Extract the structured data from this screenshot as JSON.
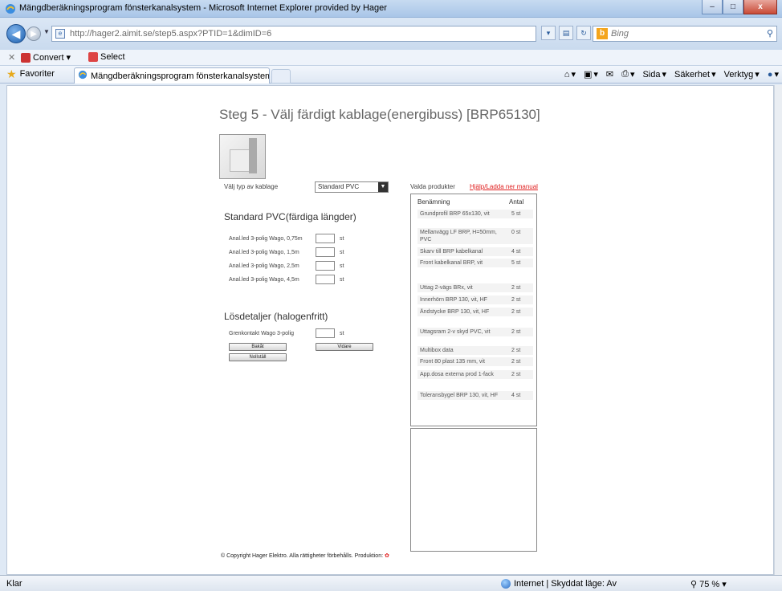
{
  "window": {
    "title": "Mängdberäkningsprogram fönsterkanalsystem - Microsoft Internet Explorer provided by Hager",
    "min_label": "–",
    "max_label": "□",
    "close_label": "x"
  },
  "address": {
    "url": "http://hager2.aimit.se/step5.aspx?PTID=1&dimID=6",
    "search_placeholder": "Bing"
  },
  "command_bar": {
    "convert_label": "Convert",
    "select_label": "Select"
  },
  "favorites": {
    "favorites_label": "Favoriter",
    "tab_title": "Mängdberäkningsprogram fönsterkanalsystem",
    "sida_label": "Sida",
    "sakerhet_label": "Säkerhet",
    "verktyg_label": "Verktyg"
  },
  "page": {
    "heading": "Steg 5 - Välj färdigt kablage(energibuss) [BRP65130]",
    "type_label": "Välj typ av kablage",
    "type_selected": "Standard PVC",
    "selected_products_label": "Valda produkter",
    "help_link": "Hjälp/Ladda ner manual",
    "section1_title": "Standard PVC(färdiga längder)",
    "section1_rows": [
      {
        "label": "Anal.led 3-polig Wago, 0,75m",
        "unit": "st"
      },
      {
        "label": "Anal.led 3-polig Wago, 1,5m",
        "unit": "st"
      },
      {
        "label": "Anal.led 3-polig Wago, 2,5m",
        "unit": "st"
      },
      {
        "label": "Anal.led 3-polig Wago, 4,5m",
        "unit": "st"
      }
    ],
    "section2_title": "Lösdetaljer (halogenfritt)",
    "section2_rows": [
      {
        "label": "Grenkontakt Wago 3-polig",
        "unit": "st"
      }
    ],
    "back_button": "Bakåt",
    "next_button": "Vidare",
    "reset_button": "Nollställ",
    "list_header_name": "Benämning",
    "list_header_qty": "Antal",
    "list_items": [
      {
        "name": "Grundprofil BRP 65x130, vit",
        "qty": "5 st"
      },
      {
        "name": "Mellanvägg LF BRP, H=50mm, PVC",
        "qty": "0 st"
      },
      {
        "name": "Skarv till BRP kabelkanal",
        "qty": "4 st"
      },
      {
        "name": "Front kabelkanal BRP, vit",
        "qty": "5 st"
      },
      {
        "name": "Uttag 2-vägs BRx, vit",
        "qty": "2 st"
      },
      {
        "name": "Innerhörn BRP 130, vit, HF",
        "qty": "2 st"
      },
      {
        "name": "Ändstycke BRP 130, vit, HF",
        "qty": "2 st"
      },
      {
        "name": "Uttagsram 2-v skyd PVC, vit",
        "qty": "2 st"
      },
      {
        "name": "Multibox data",
        "qty": "2 st"
      },
      {
        "name": "Front 80 plast 135 mm, vit",
        "qty": "2 st"
      },
      {
        "name": "App.dosa externa prod 1-fack",
        "qty": "2 st"
      },
      {
        "name": "Toleransbygel BRP 130, vit, HF",
        "qty": "4 st"
      }
    ],
    "footer": "© Copyright Hager Elektro. Alla rättigheter förbehålls. Produktion:"
  },
  "status": {
    "ready": "Klar",
    "zone": "Internet | Skyddat läge: Av",
    "zoom": "75 %"
  }
}
